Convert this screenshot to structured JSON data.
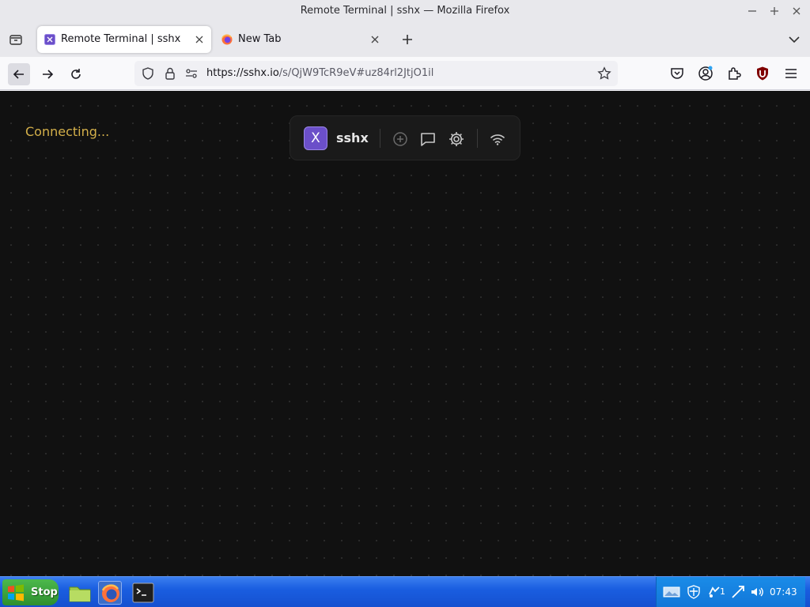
{
  "window": {
    "title": "Remote Terminal | sshx — Mozilla Firefox"
  },
  "tabs": [
    {
      "label": "Remote Terminal | sshx",
      "active": true
    },
    {
      "label": "New Tab",
      "active": false
    }
  ],
  "navbar": {
    "url_host": "https://sshx.io",
    "url_path": "/s/QjW9TcR9eV#uz84rl2JtjO1il"
  },
  "page": {
    "status_text": "Connecting...",
    "toolbar": {
      "logo_letter": "X",
      "brand": "sshx"
    }
  },
  "taskbar": {
    "start_label": "Stop",
    "tray_badge": "1",
    "clock": "07:43"
  },
  "colors": {
    "page_background": "#111111",
    "status_text": "#d4b04a",
    "logo": "#6b4fc9",
    "taskbar": "#1a5ee0"
  }
}
